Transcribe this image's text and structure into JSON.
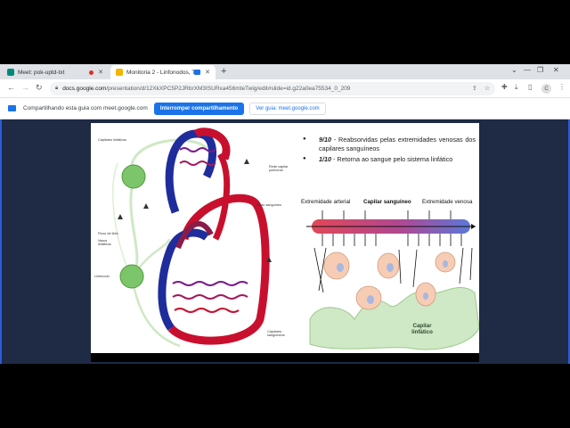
{
  "browser": {
    "tabs": [
      {
        "title": "Meet: pok-uptd-txt",
        "favicon": "google-meet-icon",
        "recording": true
      },
      {
        "title": "Monitoria 2 - Linfonodos, Ti",
        "favicon": "google-slides-icon",
        "sharing": true
      }
    ],
    "url": {
      "host": "docs.google.com",
      "path": "/presentation/d/12XkXPC5P2JRbrXM3ISURxa456mteTwig/edit#slide=id.g22a0ea75534_0_209"
    },
    "avatar_letter": "C"
  },
  "sharebar": {
    "message": "Compartilhando esta guia com meet.google.com",
    "stop_label": "Interromper compartilhamento",
    "goto_label": "Ver guia: meet.google.com"
  },
  "slide": {
    "bullets": [
      {
        "fraction": "9/10",
        "text": " - Reabsorvidas pelas extremidades venosas dos capilares sanguíneos"
      },
      {
        "fraction": "1/10",
        "text": " - Retorna ao sangue pelo sistema linfático"
      }
    ],
    "circulation_labels": {
      "capilares_linfaticos": "Capilares linfáticos",
      "rede_capilar_pulmonar": "Rede capilar pulmonar",
      "fluxo_sanguineo": "Fluxo sanguíneo",
      "fluxo_de_linfa": "Fluxo de linfa",
      "vasos_linfaticos": "Vasos linfáticos",
      "linfonodo": "Linfonodo",
      "capilares_sanguineos": "Capilares sanguíneos"
    },
    "capillary_labels": {
      "arterial_end": "Extremidade arterial",
      "capillary": "Capilar sanguíneo",
      "venous_end": "Extremidade venosa",
      "lymph_capillary": "Capilar linfático"
    }
  },
  "colors": {
    "artery": "#c8102e",
    "vein": "#1f2d9c",
    "lymph": "#7cc56a",
    "share_blue": "#1a73e8"
  }
}
